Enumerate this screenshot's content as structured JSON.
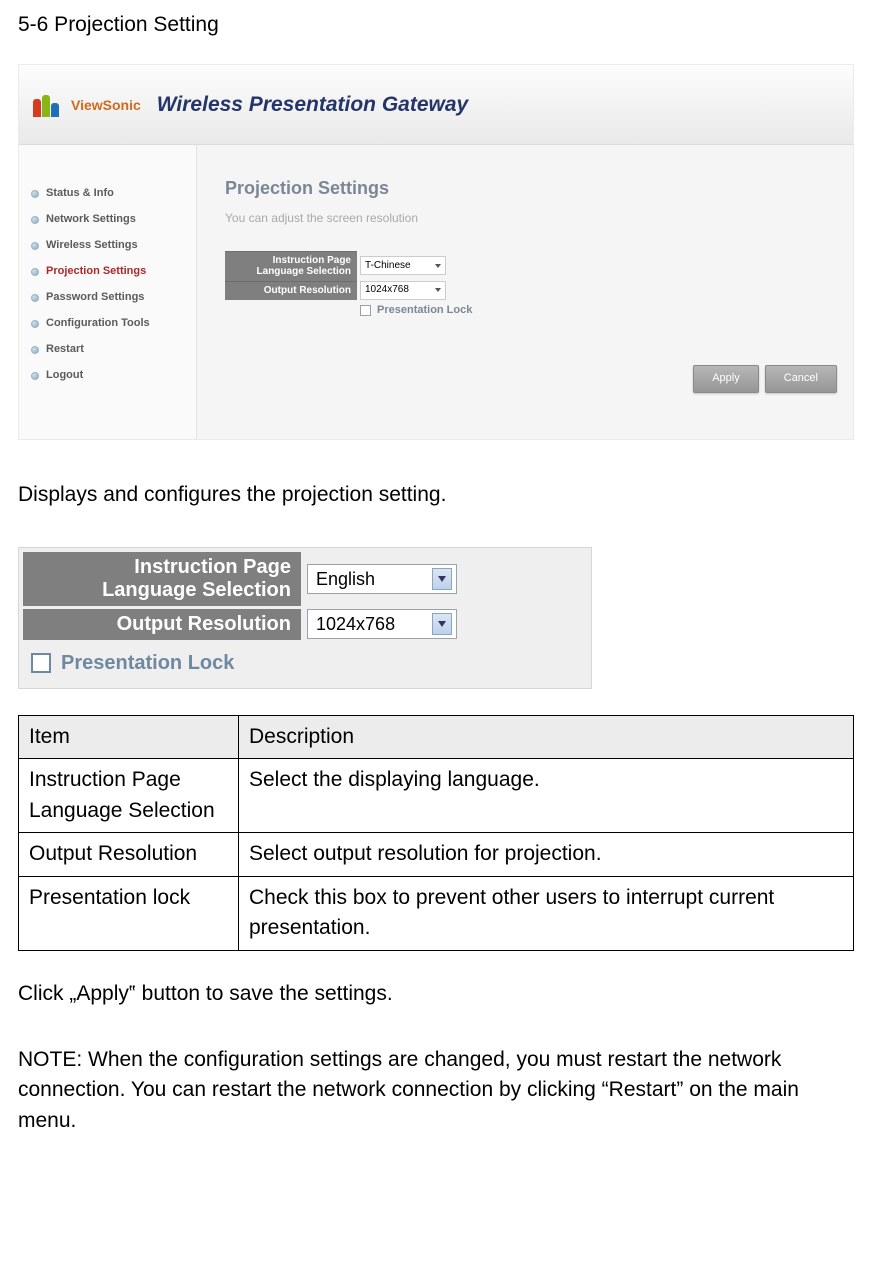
{
  "section_title": "5-6 Projection Setting",
  "screenshot": {
    "brand": "ViewSonic",
    "header_title": "Wireless Presentation Gateway",
    "sidebar": [
      {
        "label": "Status & Info",
        "active": false
      },
      {
        "label": "Network Settings",
        "active": false
      },
      {
        "label": "Wireless Settings",
        "active": false
      },
      {
        "label": "Projection Settings",
        "active": true
      },
      {
        "label": "Password Settings",
        "active": false
      },
      {
        "label": "Configuration Tools",
        "active": false
      },
      {
        "label": "Restart",
        "active": false
      },
      {
        "label": "Logout",
        "active": false
      }
    ],
    "panel_title": "Projection Settings",
    "panel_sub": "You can adjust the screen resolution",
    "lang_label": "Instruction Page Language Selection",
    "lang_value": "T-Chinese",
    "res_label": "Output Resolution",
    "res_value": "1024x768",
    "lock_label": "Presentation Lock",
    "apply": "Apply",
    "cancel": "Cancel"
  },
  "intro": "Displays and configures the projection setting.",
  "detail": {
    "lang_label_line1": "Instruction Page",
    "lang_label_line2": "Language Selection",
    "lang_value": "English",
    "res_label": "Output Resolution",
    "res_value": "1024x768",
    "lock_label": "Presentation Lock"
  },
  "table": {
    "h_item": "Item",
    "h_desc": "Description",
    "rows": [
      {
        "item": "Instruction Page Language Selection",
        "desc": "Select the displaying language."
      },
      {
        "item": "Output Resolution",
        "desc": "Select output resolution for projection."
      },
      {
        "item": "Presentation lock",
        "desc": "Check this box to prevent other users to interrupt current presentation."
      }
    ]
  },
  "apply_text": "Click „Apply‟ button to save the settings.",
  "note_text": "NOTE: When the configuration settings are changed, you must restart the network connection. You can restart the network connection by clicking “Restart” on the main menu."
}
